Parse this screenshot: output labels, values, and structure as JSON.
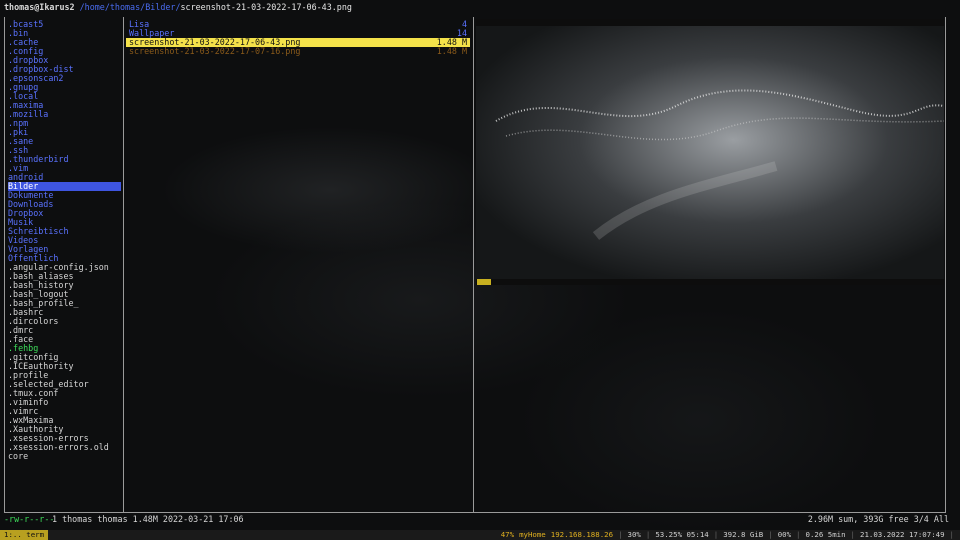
{
  "titlebar": {
    "user": "thomas@Ikarus2",
    "path": "/home/thomas/Bilder/",
    "file": "screenshot-21-03-2022-17-06-43.png"
  },
  "left_items": [
    {
      "name": ".bcast5",
      "kind": "dir"
    },
    {
      "name": ".bin",
      "kind": "dir"
    },
    {
      "name": ".cache",
      "kind": "dir"
    },
    {
      "name": ".config",
      "kind": "dir"
    },
    {
      "name": ".dropbox",
      "kind": "dir"
    },
    {
      "name": ".dropbox-dist",
      "kind": "dir"
    },
    {
      "name": ".epsonscan2",
      "kind": "dir"
    },
    {
      "name": ".gnupg",
      "kind": "dir"
    },
    {
      "name": ".local",
      "kind": "dir"
    },
    {
      "name": ".maxima",
      "kind": "dir"
    },
    {
      "name": ".mozilla",
      "kind": "dir"
    },
    {
      "name": ".npm",
      "kind": "dir"
    },
    {
      "name": ".pki",
      "kind": "dir"
    },
    {
      "name": ".sane",
      "kind": "dir"
    },
    {
      "name": ".ssh",
      "kind": "dir"
    },
    {
      "name": ".thunderbird",
      "kind": "dir"
    },
    {
      "name": ".vim",
      "kind": "dir"
    },
    {
      "name": "android",
      "kind": "dir"
    },
    {
      "name": "Bilder",
      "kind": "sel"
    },
    {
      "name": "Dokumente",
      "kind": "dir"
    },
    {
      "name": "Downloads",
      "kind": "dir"
    },
    {
      "name": "Dropbox",
      "kind": "dir"
    },
    {
      "name": "Musik",
      "kind": "dir"
    },
    {
      "name": "Schreibtisch",
      "kind": "dir"
    },
    {
      "name": "Videos",
      "kind": "dir"
    },
    {
      "name": "Vorlagen",
      "kind": "dir"
    },
    {
      "name": "Öffentlich",
      "kind": "dir"
    },
    {
      "name": ".angular-config.json",
      "kind": "file"
    },
    {
      "name": ".bash_aliases",
      "kind": "file"
    },
    {
      "name": ".bash_history",
      "kind": "file"
    },
    {
      "name": ".bash_logout",
      "kind": "file"
    },
    {
      "name": ".bash_profile_",
      "kind": "file"
    },
    {
      "name": ".bashrc",
      "kind": "file"
    },
    {
      "name": ".dircolors",
      "kind": "file"
    },
    {
      "name": ".dmrc",
      "kind": "file"
    },
    {
      "name": ".face",
      "kind": "file"
    },
    {
      "name": ".fehbg",
      "kind": "exec"
    },
    {
      "name": ".gitconfig",
      "kind": "file"
    },
    {
      "name": ".ICEauthority",
      "kind": "file"
    },
    {
      "name": ".profile",
      "kind": "file"
    },
    {
      "name": ".selected_editor",
      "kind": "file"
    },
    {
      "name": ".tmux.conf",
      "kind": "file"
    },
    {
      "name": ".viminfo",
      "kind": "file"
    },
    {
      "name": ".vimrc",
      "kind": "file"
    },
    {
      "name": ".wxMaxima",
      "kind": "file"
    },
    {
      "name": ".Xauthority",
      "kind": "file"
    },
    {
      "name": ".xsession-errors",
      "kind": "file"
    },
    {
      "name": ".xsession-errors.old",
      "kind": "file"
    },
    {
      "name": "core",
      "kind": "file"
    }
  ],
  "mid_items": [
    {
      "name": "Lisa",
      "size": "4",
      "kind": "dir"
    },
    {
      "name": "Wallpaper",
      "size": "14",
      "kind": "dir"
    },
    {
      "name": "screenshot-21-03-2022-17-06-43.png",
      "size": "1.48 M",
      "kind": "sel"
    },
    {
      "name": "screenshot-21-03-2022-17-07-16.png",
      "size": "1.48 M",
      "kind": "dim"
    }
  ],
  "status": {
    "perm": "-rw-r--r--",
    "info": "1 thomas thomas 1.48M 2022-03-21 17:06",
    "right": "2.96M sum, 393G free  3/4  All"
  },
  "bar": {
    "tag": "1:..  term",
    "items": [
      "47%",
      "myHome",
      "192.168.188.26",
      "|",
      "30%",
      "|",
      "53.25% 05:14",
      "|",
      "392.8 GiB",
      "|",
      "00%",
      "|",
      "0.26 5min",
      "|",
      "21.03.2022  17:07:49",
      "|"
    ]
  },
  "colors": {
    "accent": "#3e55e0",
    "selection": "#f4e24a",
    "dir": "#5a72ff",
    "exec": "#3ddc5a"
  }
}
